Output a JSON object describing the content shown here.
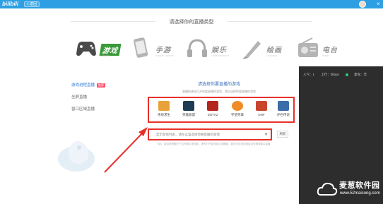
{
  "topbar": {
    "logo": "bilibili",
    "back_label": "< 返回"
  },
  "heading": "请选择你的直播类型",
  "categories": [
    {
      "label": "游戏",
      "sub": "Games",
      "active": true
    },
    {
      "label": "手游",
      "sub": "Mobile Games"
    },
    {
      "label": "娱乐",
      "sub": "Entertainment"
    },
    {
      "label": "绘画",
      "sub": "Drawing"
    },
    {
      "label": "电台",
      "sub": "Radio"
    }
  ],
  "left_menu": [
    {
      "label": "游戏进程直播",
      "badge": "推荐",
      "active": true
    },
    {
      "label": "全屏直播"
    },
    {
      "label": "窗口区域直播"
    }
  ],
  "panel": {
    "title": "请选择你要直播的游戏",
    "sub": "直播前请先打开你要直播的游戏，然后选择你要直播的游戏",
    "games": [
      {
        "name": "绝地求生",
        "color": "#e8a23a"
      },
      {
        "name": "英雄联盟",
        "color": "#1d3b56"
      },
      {
        "name": "DOTA2",
        "color": "#b3261e"
      },
      {
        "name": "守望先锋",
        "color": "#f08a24"
      },
      {
        "name": "DNF",
        "color": "#c8442b"
      },
      {
        "name": "炉石传说",
        "color": "#3a6ea8"
      }
    ],
    "select_text": "显示游戏列表，请在这里选择你要直播的游戏",
    "refresh_label": "刷新",
    "tip": "Tips：若游戏进程在下拉列表中未找到，请先打开游戏后点击刷新，若仍无法找到请尝试全屏或窗口直播"
  },
  "stats": {
    "popularity": "人气：1",
    "bitrate": "上行：0kbps",
    "mic": "麦克：无"
  },
  "watermark": {
    "text": "麦葱软件园",
    "url": "www.52maicong.com"
  }
}
